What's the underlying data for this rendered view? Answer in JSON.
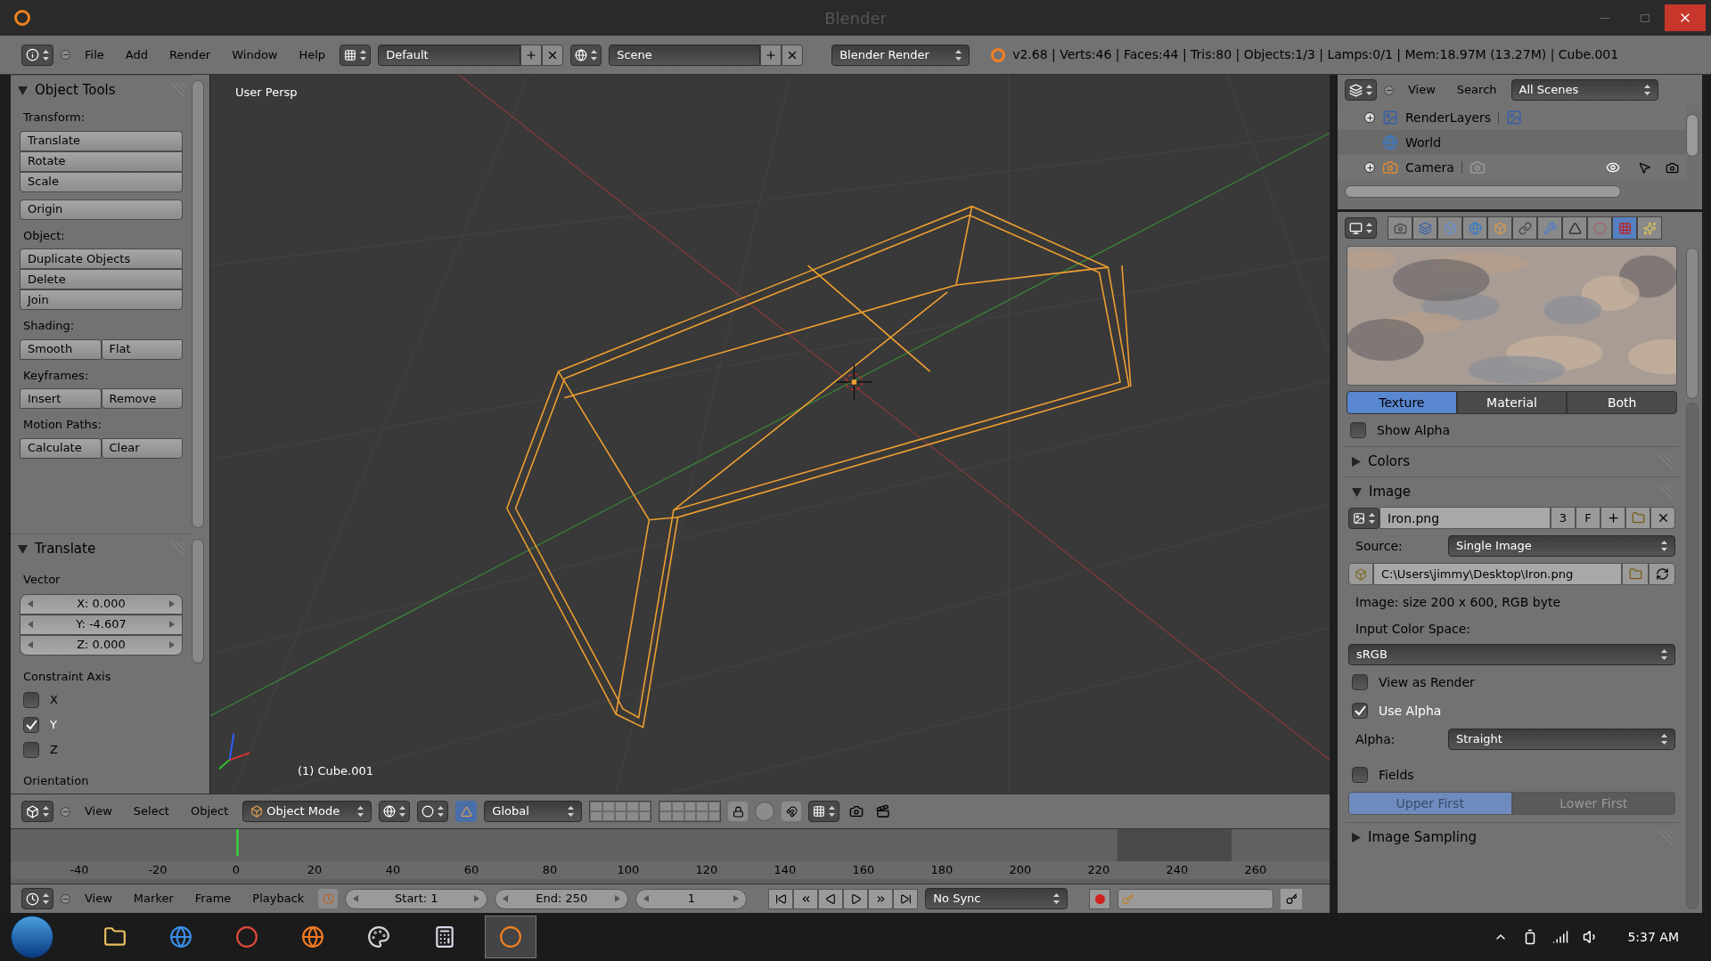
{
  "window": {
    "title": "Blender"
  },
  "info_header": {
    "menus": [
      "File",
      "Add",
      "Render",
      "Window",
      "Help"
    ],
    "layout": "Default",
    "scene": "Scene",
    "engine": "Blender Render",
    "stats": "v2.68 | Verts:46 | Faces:44 | Tris:80 | Objects:1/3 | Lamps:0/1 | Mem:18.97M (13.27M) | Cube.001"
  },
  "tool_shelf": {
    "title": "Object Tools",
    "groups": [
      {
        "label": "Transform:",
        "kind": "stack",
        "buttons": [
          "Translate",
          "Rotate",
          "Scale"
        ]
      },
      {
        "kind": "stack",
        "buttons": [
          "Origin"
        ]
      },
      {
        "label": "Object:",
        "kind": "stack",
        "buttons": [
          "Duplicate Objects",
          "Delete",
          "Join"
        ]
      },
      {
        "label": "Shading:",
        "kind": "row",
        "buttons": [
          "Smooth",
          "Flat"
        ]
      },
      {
        "label": "Keyframes:",
        "kind": "row",
        "buttons": [
          "Insert",
          "Remove"
        ]
      },
      {
        "label": "Motion Paths:",
        "kind": "row",
        "buttons": [
          "Calculate",
          "Clear"
        ]
      }
    ]
  },
  "operator_panel": {
    "title": "Translate",
    "vector_label": "Vector",
    "vector": [
      "X: 0.000",
      "Y: -4.607",
      "Z: 0.000"
    ],
    "constraint_label": "Constraint Axis",
    "axes": [
      {
        "label": "X",
        "checked": false
      },
      {
        "label": "Y",
        "checked": true
      },
      {
        "label": "Z",
        "checked": false
      }
    ],
    "orientation_label": "Orientation"
  },
  "viewport": {
    "view_label": "User Persp",
    "object_label": "(1) Cube.001"
  },
  "viewport_header": {
    "menus": [
      "View",
      "Select",
      "Object"
    ],
    "mode": "Object Mode",
    "orientation": "Global"
  },
  "timeline": {
    "ticks": [
      {
        "label": "-40",
        "current": false
      },
      {
        "label": "-20",
        "current": false
      },
      {
        "label": "0",
        "current": true
      },
      {
        "label": "20",
        "current": false
      },
      {
        "label": "40",
        "current": false
      },
      {
        "label": "60",
        "current": false
      },
      {
        "label": "80",
        "current": false
      },
      {
        "label": "100",
        "current": false
      },
      {
        "label": "120",
        "current": false
      },
      {
        "label": "140",
        "current": false
      },
      {
        "label": "160",
        "current": false
      },
      {
        "label": "180",
        "current": false
      },
      {
        "label": "200",
        "current": false
      },
      {
        "label": "220",
        "current": false
      },
      {
        "label": "240",
        "current": false
      },
      {
        "label": "260",
        "current": false
      }
    ]
  },
  "timeline_header": {
    "menus": [
      "View",
      "Marker",
      "Frame",
      "Playback"
    ],
    "start": "Start: 1",
    "end": "End: 250",
    "frame": "1",
    "sync": "No Sync"
  },
  "outliner": {
    "menus": [
      "View",
      "Search"
    ],
    "filter": "All Scenes",
    "items": [
      {
        "label": "RenderLayers",
        "kind": "renderlayers",
        "expandable": true
      },
      {
        "label": "World",
        "kind": "world",
        "expandable": false
      },
      {
        "label": "Camera",
        "kind": "camera",
        "expandable": true
      }
    ]
  },
  "properties": {
    "tabs": [
      {
        "kind": "render",
        "selected": false
      },
      {
        "kind": "layers",
        "selected": false
      },
      {
        "kind": "scene",
        "selected": false
      },
      {
        "kind": "world",
        "selected": false
      },
      {
        "kind": "object",
        "selected": false
      },
      {
        "kind": "constraints",
        "selected": false
      },
      {
        "kind": "modifiers",
        "selected": false
      },
      {
        "kind": "data",
        "selected": false
      },
      {
        "kind": "material",
        "selected": false
      },
      {
        "kind": "texture",
        "selected": true
      },
      {
        "kind": "particles",
        "selected": false
      }
    ],
    "preview_modes": [
      {
        "label": "Texture",
        "selected": true
      },
      {
        "label": "Material",
        "selected": false
      },
      {
        "label": "Both",
        "selected": false
      }
    ],
    "show_alpha": {
      "label": "Show Alpha",
      "checked": false
    },
    "colors_panel": {
      "title": "Colors",
      "expanded": false
    },
    "image_panel": {
      "title": "Image",
      "expanded": true,
      "image_name": "Iron.png",
      "users": "3",
      "fake": "F",
      "source_label": "Source:",
      "source": "Single Image",
      "filepath": "C:\\Users\\jimmy\\Desktop\\Iron.png",
      "info": "Image: size 200 x 600, RGB byte",
      "color_space_label": "Input Color Space:",
      "color_space": "sRGB",
      "view_as_render": {
        "label": "View as Render",
        "checked": false
      },
      "use_alpha": {
        "label": "Use Alpha",
        "checked": true
      },
      "alpha_label": "Alpha:",
      "alpha": "Straight",
      "fields": {
        "label": "Fields",
        "checked": false
      },
      "field_order": [
        {
          "label": "Upper First",
          "selected": true
        },
        {
          "label": "Lower First",
          "selected": false
        }
      ]
    },
    "sampling_panel": {
      "title": "Image Sampling",
      "expanded": false
    }
  },
  "taskbar": {
    "time": "5:37 AM",
    "apps": [
      {
        "kind": "folder",
        "selected": false
      },
      {
        "kind": "browser-e",
        "selected": false
      },
      {
        "kind": "browser-round",
        "selected": false
      },
      {
        "kind": "fox",
        "selected": false
      },
      {
        "kind": "paint",
        "selected": false
      },
      {
        "kind": "calculator",
        "selected": false
      },
      {
        "kind": "blender",
        "selected": true
      }
    ]
  }
}
